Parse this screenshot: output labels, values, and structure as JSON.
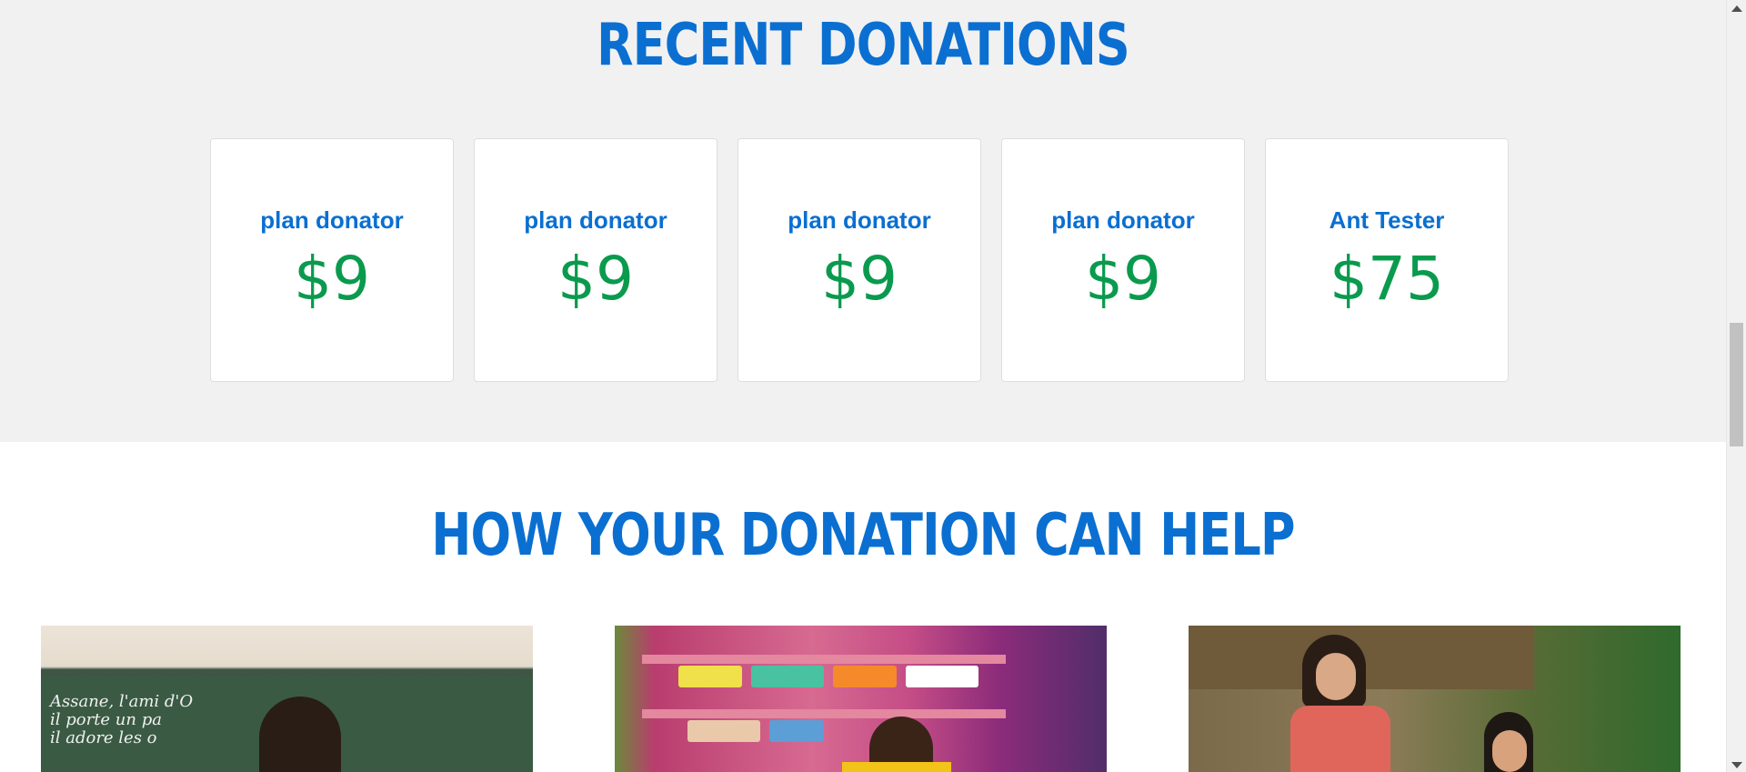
{
  "recent_donations": {
    "title": "RECENT DONATIONS",
    "cards": [
      {
        "name": "plan donator",
        "amount": "$9"
      },
      {
        "name": "plan donator",
        "amount": "$9"
      },
      {
        "name": "plan donator",
        "amount": "$9"
      },
      {
        "name": "plan donator",
        "amount": "$9"
      },
      {
        "name": "Ant Tester",
        "amount": "$75"
      }
    ]
  },
  "how_to_help": {
    "title": "HOW YOUR DONATION CAN HELP",
    "images": [
      {
        "board_text": "Assane, l'ami d'O\nil porte un pa\nil adore les o"
      },
      {},
      {}
    ]
  },
  "colors": {
    "title_blue": "#0a6fd1",
    "amount_green": "#0a9a4e",
    "section_bg": "#f1f1f1"
  }
}
